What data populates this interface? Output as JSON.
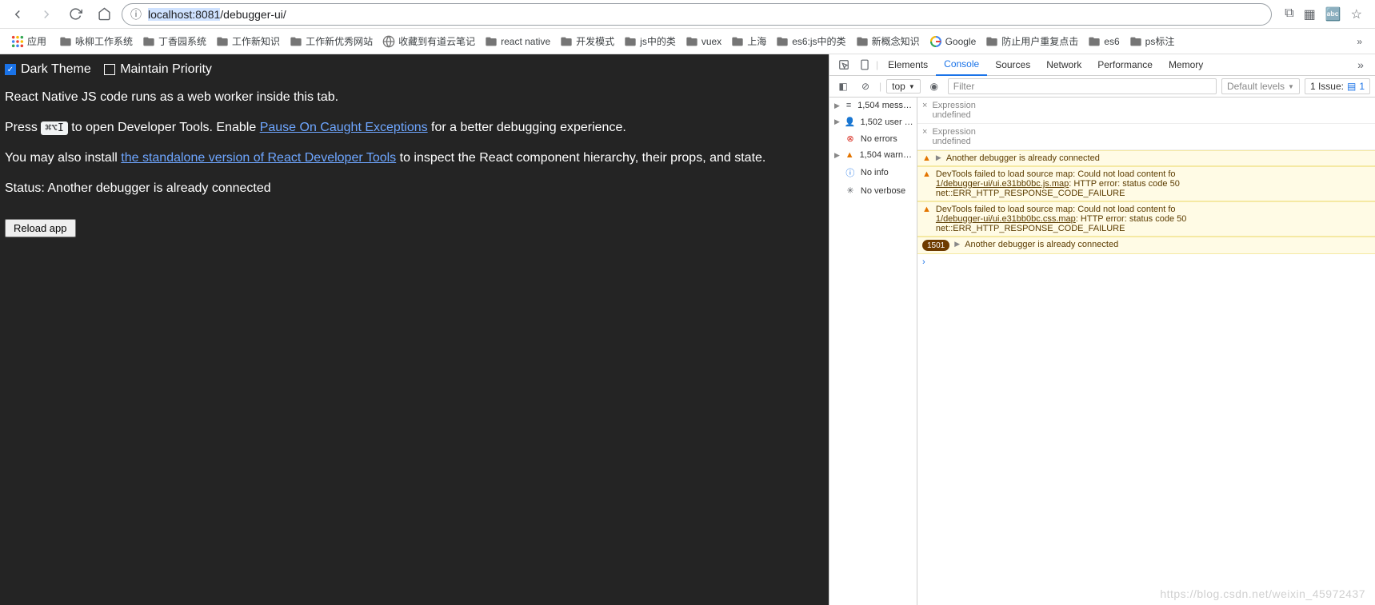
{
  "url": {
    "highlighted": "localhost:8081",
    "rest": "/debugger-ui/"
  },
  "bookmarks": {
    "apps": "应用",
    "items": [
      {
        "label": "咏柳工作系统",
        "type": "folder"
      },
      {
        "label": "丁香园系统",
        "type": "folder"
      },
      {
        "label": "工作新知识",
        "type": "folder"
      },
      {
        "label": "工作新优秀网站",
        "type": "folder"
      },
      {
        "label": "收藏到有道云笔记",
        "type": "globe"
      },
      {
        "label": "react native",
        "type": "folder"
      },
      {
        "label": "开发模式",
        "type": "folder"
      },
      {
        "label": "js中的类",
        "type": "folder"
      },
      {
        "label": "vuex",
        "type": "folder"
      },
      {
        "label": "上海",
        "type": "folder"
      },
      {
        "label": "es6:js中的类",
        "type": "folder"
      },
      {
        "label": "新概念知识",
        "type": "folder"
      },
      {
        "label": "Google",
        "type": "google"
      },
      {
        "label": "防止用户重复点击",
        "type": "folder"
      },
      {
        "label": "es6",
        "type": "folder"
      },
      {
        "label": "ps标注",
        "type": "folder"
      }
    ]
  },
  "page": {
    "darkTheme": "Dark Theme",
    "maintainPriority": "Maintain Priority",
    "line1": "React Native JS code runs as a web worker inside this tab.",
    "pressPrefix": "Press ",
    "kbd": "⌘⌥I",
    "pressSuffix": " to open Developer Tools. Enable ",
    "pauseLink": "Pause On Caught Exceptions",
    "pressTail": " for a better debugging experience.",
    "installPrefix": "You may also install ",
    "installLink": "the standalone version of React Developer Tools",
    "installTail": " to inspect the React component hierarchy, their props, and state.",
    "status": "Status: Another debugger is already connected",
    "reloadBtn": "Reload app"
  },
  "devtools": {
    "tabs": [
      "Elements",
      "Console",
      "Sources",
      "Network",
      "Performance",
      "Memory"
    ],
    "activeTab": "Console",
    "context": "top",
    "filterPlaceholder": "Filter",
    "levels": "Default levels",
    "issuesLabel": "1 Issue:",
    "issuesCount": "1",
    "sidebar": {
      "messages": "1,504 mess…",
      "user": "1,502 user …",
      "errors": "No errors",
      "warnings": "1,504 warn…",
      "info": "No info",
      "verbose": "No verbose"
    },
    "expr": {
      "label": "Expression",
      "value": "undefined"
    },
    "warn1": "Another debugger is already connected",
    "warn2a": "DevTools failed to load source map: Could not load content fo",
    "warn2link": "1/debugger-ui/ui.e31bb0bc.js.map",
    "warn2b": ": HTTP error: status code 50",
    "warn2c": "net::ERR_HTTP_RESPONSE_CODE_FAILURE",
    "warn3a": "DevTools failed to load source map: Could not load content fo",
    "warn3link": "1/debugger-ui/ui.e31bb0bc.css.map",
    "warn3b": ": HTTP error: status code 50",
    "warn3c": "net::ERR_HTTP_RESPONSE_CODE_FAILURE",
    "warn4count": "1501",
    "warn4": "Another debugger is already connected"
  },
  "watermark": "https://blog.csdn.net/weixin_45972437"
}
